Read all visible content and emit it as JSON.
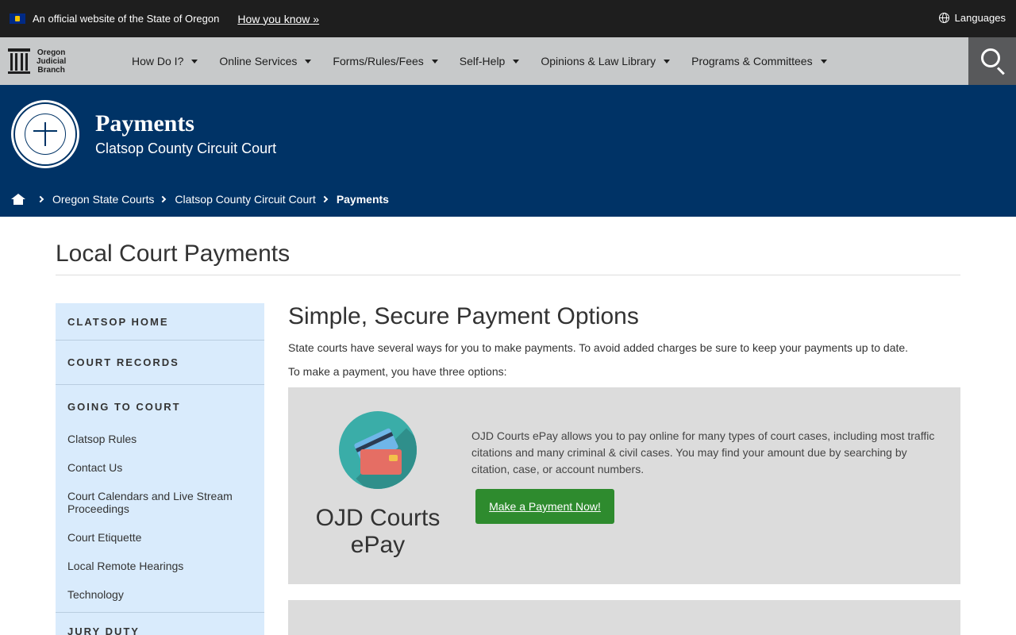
{
  "banner": {
    "official_text": "An official website of the State of Oregon",
    "how_you_know": "How you know »",
    "languages": "Languages"
  },
  "nav": {
    "logo_line1": "Oregon",
    "logo_line2": "Judicial",
    "logo_line3": "Branch",
    "items": [
      {
        "label": "How Do I?"
      },
      {
        "label": "Online Services"
      },
      {
        "label": "Forms/Rules/Fees"
      },
      {
        "label": "Self-Help"
      },
      {
        "label": "Opinions & Law Library"
      },
      {
        "label": "Programs & Committees"
      }
    ]
  },
  "hero": {
    "title": "Payments",
    "subtitle": "Clatsop County Circuit Court",
    "breadcrumb": [
      "Oregon State Courts",
      "Clatsop County Circuit Court",
      "Payments"
    ]
  },
  "page": {
    "title": "Local Court Payments"
  },
  "sidebar": {
    "clatsop_home": "CLATSOP HOME",
    "court_records": "COURT RECORDS",
    "going_to_court": "GOING TO COURT",
    "links": [
      "Clatsop Rules",
      "Contact Us",
      "Court Calendars and Live Stream Proceedings",
      "Court Etiquette",
      "Local Remote Hearings",
      "Technology"
    ],
    "jury_duty": "JURY DUTY"
  },
  "main": {
    "heading": "Simple, Secure Payment Options",
    "intro": "State courts have several ways for you to make payments. To avoid added charges be sure to keep your payments up to date.",
    "options_text": "To make a payment, you have three options:"
  },
  "epay": {
    "title_line1": "OJD Courts",
    "title_line2": "ePay",
    "description": "OJD Courts ePay allows you to pay online for many types of court cases, including most traffic citations and many criminal & civil cases. You may find your amount due by searching by citation, case, or account numbers.",
    "button_label": "Make a Payment Now!"
  }
}
